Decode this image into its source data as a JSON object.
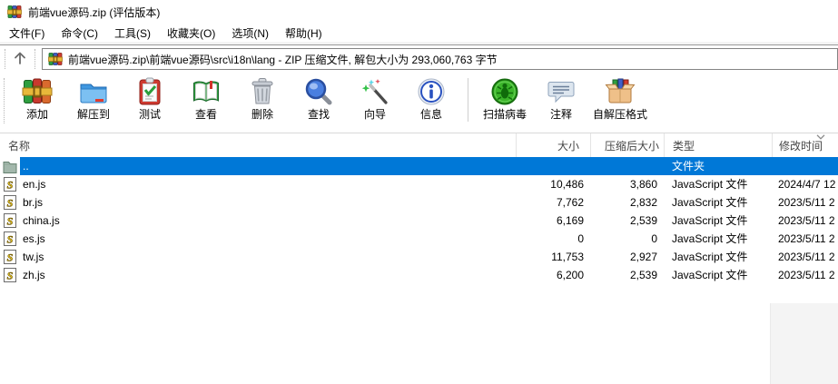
{
  "window": {
    "title": "前端vue源码.zip (评估版本)"
  },
  "menu": {
    "items": [
      {
        "id": "file",
        "label": "文件(F)"
      },
      {
        "id": "commands",
        "label": "命令(C)"
      },
      {
        "id": "tools",
        "label": "工具(S)"
      },
      {
        "id": "favorites",
        "label": "收藏夹(O)"
      },
      {
        "id": "options",
        "label": "选项(N)"
      },
      {
        "id": "help",
        "label": "帮助(H)"
      }
    ]
  },
  "addressbar": {
    "path_text": "前端vue源码.zip\\前端vue源码\\src\\i18n\\lang - ZIP 压缩文件, 解包大小为 293,060,763 字节"
  },
  "toolbar": {
    "buttons": [
      {
        "id": "add",
        "label": "添加",
        "icon": "add-books-icon"
      },
      {
        "id": "extract-to",
        "label": "解压到",
        "icon": "extract-folder-icon"
      },
      {
        "id": "test",
        "label": "测试",
        "icon": "test-clipboard-icon"
      },
      {
        "id": "view",
        "label": "查看",
        "icon": "view-book-icon"
      },
      {
        "id": "delete",
        "label": "删除",
        "icon": "delete-trash-icon"
      },
      {
        "id": "find",
        "label": "查找",
        "icon": "find-magnifier-icon"
      },
      {
        "id": "wizard",
        "label": "向导",
        "icon": "wizard-wand-icon"
      },
      {
        "id": "info",
        "label": "信息",
        "icon": "info-icon"
      },
      {
        "id": "scan-virus",
        "label": "扫描病毒",
        "icon": "scan-virus-icon",
        "separator_before": true
      },
      {
        "id": "comment",
        "label": "注释",
        "icon": "comment-icon"
      },
      {
        "id": "sfx",
        "label": "自解压格式",
        "icon": "sfx-box-icon"
      }
    ]
  },
  "list": {
    "columns": [
      {
        "id": "name",
        "label": "名称"
      },
      {
        "id": "size",
        "label": "大小"
      },
      {
        "id": "packed-size",
        "label": "压缩后大小"
      },
      {
        "id": "type",
        "label": "类型"
      },
      {
        "id": "modified-time",
        "label": "修改时间",
        "sorted": "desc"
      }
    ],
    "rows": [
      {
        "name": "..",
        "icon": "folder-up-icon",
        "size": "",
        "packed": "",
        "type": "文件夹",
        "mtime": "",
        "selected": true
      },
      {
        "name": "en.js",
        "icon": "js-file-icon",
        "size": "10,486",
        "packed": "3,860",
        "type": "JavaScript 文件",
        "mtime": "2024/4/7 12",
        "selected": false
      },
      {
        "name": "br.js",
        "icon": "js-file-icon",
        "size": "7,762",
        "packed": "2,832",
        "type": "JavaScript 文件",
        "mtime": "2023/5/11 2",
        "selected": false
      },
      {
        "name": "china.js",
        "icon": "js-file-icon",
        "size": "6,169",
        "packed": "2,539",
        "type": "JavaScript 文件",
        "mtime": "2023/5/11 2",
        "selected": false
      },
      {
        "name": "es.js",
        "icon": "js-file-icon",
        "size": "0",
        "packed": "0",
        "type": "JavaScript 文件",
        "mtime": "2023/5/11 2",
        "selected": false
      },
      {
        "name": "tw.js",
        "icon": "js-file-icon",
        "size": "11,753",
        "packed": "2,927",
        "type": "JavaScript 文件",
        "mtime": "2023/5/11 2",
        "selected": false
      },
      {
        "name": "zh.js",
        "icon": "js-file-icon",
        "size": "6,200",
        "packed": "2,539",
        "type": "JavaScript 文件",
        "mtime": "2023/5/11 2",
        "selected": false
      }
    ]
  },
  "colors": {
    "selection": "#0078d7",
    "selection_text": "#ffffff",
    "header_text": "#454545"
  }
}
